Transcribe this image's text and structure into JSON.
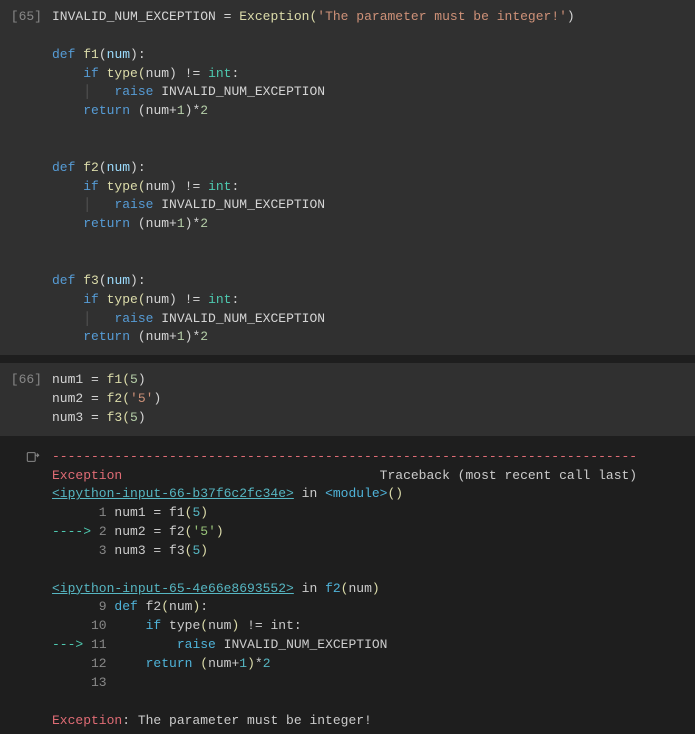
{
  "cells": [
    {
      "prompt": "[65]",
      "lines": [
        [
          {
            "t": "INVALID_NUM_EXCEPTION ",
            "c": "const"
          },
          {
            "t": "=",
            "c": "op"
          },
          {
            "t": " Exception(",
            "c": "fn"
          },
          {
            "t": "'The parameter must be integer!'",
            "c": "str"
          },
          {
            "t": ")",
            "c": "pun"
          }
        ],
        [
          {
            "t": "",
            "c": ""
          }
        ],
        [
          {
            "t": "def ",
            "c": "kw"
          },
          {
            "t": "f1",
            "c": "fn"
          },
          {
            "t": "(",
            "c": "pun"
          },
          {
            "t": "num",
            "c": "param"
          },
          {
            "t": "):",
            "c": "pun"
          }
        ],
        [
          {
            "t": "    ",
            "c": ""
          },
          {
            "t": "if ",
            "c": "kw"
          },
          {
            "t": "type(",
            "c": "fn"
          },
          {
            "t": "num",
            "c": "var"
          },
          {
            "t": ") ",
            "c": "pun"
          },
          {
            "t": "!=",
            "c": "op"
          },
          {
            "t": " ",
            "c": ""
          },
          {
            "t": "int",
            "c": "type"
          },
          {
            "t": ":",
            "c": "pun"
          }
        ],
        [
          {
            "t": "    ",
            "c": ""
          },
          {
            "t": "│   ",
            "c": "indent-guide"
          },
          {
            "t": "raise ",
            "c": "kw"
          },
          {
            "t": "INVALID_NUM_EXCEPTION",
            "c": "const"
          }
        ],
        [
          {
            "t": "    ",
            "c": ""
          },
          {
            "t": "return ",
            "c": "kw"
          },
          {
            "t": "(",
            "c": "pun"
          },
          {
            "t": "num",
            "c": "var"
          },
          {
            "t": "+",
            "c": "op"
          },
          {
            "t": "1",
            "c": "num"
          },
          {
            "t": ")",
            "c": "pun"
          },
          {
            "t": "*",
            "c": "op"
          },
          {
            "t": "2",
            "c": "num"
          }
        ],
        [
          {
            "t": "",
            "c": ""
          }
        ],
        [
          {
            "t": "",
            "c": ""
          }
        ],
        [
          {
            "t": "def ",
            "c": "kw"
          },
          {
            "t": "f2",
            "c": "fn"
          },
          {
            "t": "(",
            "c": "pun"
          },
          {
            "t": "num",
            "c": "param"
          },
          {
            "t": "):",
            "c": "pun"
          }
        ],
        [
          {
            "t": "    ",
            "c": ""
          },
          {
            "t": "if ",
            "c": "kw"
          },
          {
            "t": "type(",
            "c": "fn"
          },
          {
            "t": "num",
            "c": "var"
          },
          {
            "t": ") ",
            "c": "pun"
          },
          {
            "t": "!=",
            "c": "op"
          },
          {
            "t": " ",
            "c": ""
          },
          {
            "t": "int",
            "c": "type"
          },
          {
            "t": ":",
            "c": "pun"
          }
        ],
        [
          {
            "t": "    ",
            "c": ""
          },
          {
            "t": "│   ",
            "c": "indent-guide"
          },
          {
            "t": "raise ",
            "c": "kw"
          },
          {
            "t": "INVALID_NUM_EXCEPTION",
            "c": "const"
          }
        ],
        [
          {
            "t": "    ",
            "c": ""
          },
          {
            "t": "return ",
            "c": "kw"
          },
          {
            "t": "(",
            "c": "pun"
          },
          {
            "t": "num",
            "c": "var"
          },
          {
            "t": "+",
            "c": "op"
          },
          {
            "t": "1",
            "c": "num"
          },
          {
            "t": ")",
            "c": "pun"
          },
          {
            "t": "*",
            "c": "op"
          },
          {
            "t": "2",
            "c": "num"
          }
        ],
        [
          {
            "t": "",
            "c": ""
          }
        ],
        [
          {
            "t": "",
            "c": ""
          }
        ],
        [
          {
            "t": "def ",
            "c": "kw"
          },
          {
            "t": "f3",
            "c": "fn"
          },
          {
            "t": "(",
            "c": "pun"
          },
          {
            "t": "num",
            "c": "param"
          },
          {
            "t": "):",
            "c": "pun"
          }
        ],
        [
          {
            "t": "    ",
            "c": ""
          },
          {
            "t": "if ",
            "c": "kw"
          },
          {
            "t": "type(",
            "c": "fn"
          },
          {
            "t": "num",
            "c": "var"
          },
          {
            "t": ") ",
            "c": "pun"
          },
          {
            "t": "!=",
            "c": "op"
          },
          {
            "t": " ",
            "c": ""
          },
          {
            "t": "int",
            "c": "type"
          },
          {
            "t": ":",
            "c": "pun"
          }
        ],
        [
          {
            "t": "    ",
            "c": ""
          },
          {
            "t": "│   ",
            "c": "indent-guide"
          },
          {
            "t": "raise ",
            "c": "kw"
          },
          {
            "t": "INVALID_NUM_EXCEPTION",
            "c": "const"
          }
        ],
        [
          {
            "t": "    ",
            "c": ""
          },
          {
            "t": "return ",
            "c": "kw"
          },
          {
            "t": "(",
            "c": "pun"
          },
          {
            "t": "num",
            "c": "var"
          },
          {
            "t": "+",
            "c": "op"
          },
          {
            "t": "1",
            "c": "num"
          },
          {
            "t": ")",
            "c": "pun"
          },
          {
            "t": "*",
            "c": "op"
          },
          {
            "t": "2",
            "c": "num"
          }
        ]
      ]
    },
    {
      "prompt": "[66]",
      "lines": [
        [
          {
            "t": "num1 ",
            "c": "var"
          },
          {
            "t": "=",
            "c": "op"
          },
          {
            "t": " f1(",
            "c": "fn"
          },
          {
            "t": "5",
            "c": "num"
          },
          {
            "t": ")",
            "c": "pun"
          }
        ],
        [
          {
            "t": "num2 ",
            "c": "var"
          },
          {
            "t": "=",
            "c": "op"
          },
          {
            "t": " f2(",
            "c": "fn"
          },
          {
            "t": "'5'",
            "c": "str"
          },
          {
            "t": ")",
            "c": "pun"
          }
        ],
        [
          {
            "t": "num3 ",
            "c": "var"
          },
          {
            "t": "=",
            "c": "op"
          },
          {
            "t": " f3(",
            "c": "fn"
          },
          {
            "t": "5",
            "c": "num"
          },
          {
            "t": ")",
            "c": "pun"
          }
        ]
      ]
    }
  ],
  "output": {
    "lines": [
      [
        {
          "t": "---------------------------------------------------------------------------",
          "c": "dash"
        }
      ],
      [
        {
          "t": "Exception",
          "c": "err-name"
        },
        {
          "t": "                                 Traceback (most recent call last)",
          "c": "tb"
        }
      ],
      [
        {
          "t": "<ipython-input-66-b37f6c2fc34e>",
          "c": "link"
        },
        {
          "t": " in ",
          "c": "tb"
        },
        {
          "t": "<module>",
          "c": "tb-fn"
        },
        {
          "t": "()",
          "c": "tb-paren"
        }
      ],
      [
        {
          "t": "      1",
          "c": "lineno"
        },
        {
          "t": " num1 ",
          "c": "tb"
        },
        {
          "t": "=",
          "c": "tb-op"
        },
        {
          "t": " f1",
          "c": "tb"
        },
        {
          "t": "(",
          "c": "tb-paren"
        },
        {
          "t": "5",
          "c": "tb-num"
        },
        {
          "t": ")",
          "c": "tb-paren"
        }
      ],
      [
        {
          "t": "----> ",
          "c": "arrow"
        },
        {
          "t": "2",
          "c": "lineno"
        },
        {
          "t": " num2 ",
          "c": "tb"
        },
        {
          "t": "=",
          "c": "tb-op"
        },
        {
          "t": " f2",
          "c": "tb"
        },
        {
          "t": "(",
          "c": "tb-paren"
        },
        {
          "t": "'5'",
          "c": "tb-str"
        },
        {
          "t": ")",
          "c": "tb-paren"
        }
      ],
      [
        {
          "t": "      3",
          "c": "lineno"
        },
        {
          "t": " num3 ",
          "c": "tb"
        },
        {
          "t": "=",
          "c": "tb-op"
        },
        {
          "t": " f3",
          "c": "tb"
        },
        {
          "t": "(",
          "c": "tb-paren"
        },
        {
          "t": "5",
          "c": "tb-num"
        },
        {
          "t": ")",
          "c": "tb-paren"
        }
      ],
      [
        {
          "t": "",
          "c": ""
        }
      ],
      [
        {
          "t": "<ipython-input-65-4e66e8693552>",
          "c": "link"
        },
        {
          "t": " in ",
          "c": "tb"
        },
        {
          "t": "f2",
          "c": "tb-fn"
        },
        {
          "t": "(",
          "c": "tb-paren"
        },
        {
          "t": "num",
          "c": "tb"
        },
        {
          "t": ")",
          "c": "tb-paren"
        }
      ],
      [
        {
          "t": "      9",
          "c": "lineno"
        },
        {
          "t": " ",
          "c": ""
        },
        {
          "t": "def",
          "c": "tb-kw"
        },
        {
          "t": " f2",
          "c": "tb"
        },
        {
          "t": "(",
          "c": "tb-paren"
        },
        {
          "t": "num",
          "c": "tb"
        },
        {
          "t": ")",
          "c": "tb-paren"
        },
        {
          "t": ":",
          "c": "tb-op"
        }
      ],
      [
        {
          "t": "     10",
          "c": "lineno"
        },
        {
          "t": "     ",
          "c": ""
        },
        {
          "t": "if",
          "c": "tb-kw"
        },
        {
          "t": " type",
          "c": "tb"
        },
        {
          "t": "(",
          "c": "tb-paren"
        },
        {
          "t": "num",
          "c": "tb"
        },
        {
          "t": ")",
          "c": "tb-paren"
        },
        {
          "t": " ",
          "c": ""
        },
        {
          "t": "!=",
          "c": "tb-op"
        },
        {
          "t": " int",
          "c": "tb"
        },
        {
          "t": ":",
          "c": "tb-op"
        }
      ],
      [
        {
          "t": "---> ",
          "c": "arrow"
        },
        {
          "t": "11",
          "c": "lineno"
        },
        {
          "t": "         ",
          "c": ""
        },
        {
          "t": "raise",
          "c": "tb-kw"
        },
        {
          "t": " INVALID_NUM_EXCEPTION",
          "c": "tb"
        }
      ],
      [
        {
          "t": "     12",
          "c": "lineno"
        },
        {
          "t": "     ",
          "c": ""
        },
        {
          "t": "return",
          "c": "tb-kw"
        },
        {
          "t": " ",
          "c": ""
        },
        {
          "t": "(",
          "c": "tb-paren"
        },
        {
          "t": "num",
          "c": "tb"
        },
        {
          "t": "+",
          "c": "tb-op"
        },
        {
          "t": "1",
          "c": "tb-num"
        },
        {
          "t": ")",
          "c": "tb-paren"
        },
        {
          "t": "*",
          "c": "tb-op"
        },
        {
          "t": "2",
          "c": "tb-num"
        }
      ],
      [
        {
          "t": "     13",
          "c": "lineno"
        }
      ],
      [
        {
          "t": "",
          "c": ""
        }
      ],
      [
        {
          "t": "Exception",
          "c": "err-name"
        },
        {
          "t": ": The parameter must be integer!",
          "c": "tb"
        }
      ]
    ]
  }
}
